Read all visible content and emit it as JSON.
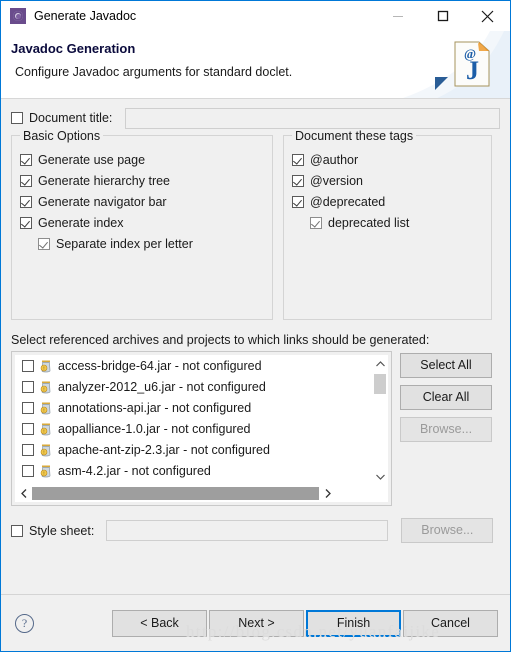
{
  "window": {
    "title": "Generate Javadoc",
    "icon": "gear-icon",
    "controls": {
      "minimize": "minimize-icon",
      "maximize": "maximize-icon",
      "close": "close-icon"
    }
  },
  "header": {
    "title": "Javadoc Generation",
    "subtitle": "Configure Javadoc arguments for standard doclet.",
    "logo": "javadoc-page-icon"
  },
  "document_title": {
    "label": "Document title:",
    "checked": false,
    "value": "",
    "placeholder": "",
    "enabled": false
  },
  "basic_options": {
    "title": "Basic Options",
    "items": [
      {
        "label": "Generate use page",
        "checked": true,
        "indent": false
      },
      {
        "label": "Generate hierarchy tree",
        "checked": true,
        "indent": false
      },
      {
        "label": "Generate navigator bar",
        "checked": true,
        "indent": false
      },
      {
        "label": "Generate index",
        "checked": true,
        "indent": false
      },
      {
        "label": "Separate index per letter",
        "checked": true,
        "indent": true
      }
    ]
  },
  "document_tags": {
    "title": "Document these tags",
    "items": [
      {
        "label": "@author",
        "checked": true,
        "indent": false
      },
      {
        "label": "@version",
        "checked": true,
        "indent": false
      },
      {
        "label": "@deprecated",
        "checked": true,
        "indent": false
      },
      {
        "label": "deprecated list",
        "checked": true,
        "indent": true
      }
    ]
  },
  "references": {
    "label": "Select referenced archives and projects to which links should be generated:",
    "items": [
      {
        "name": "access-bridge-64.jar - not configured",
        "checked": false,
        "icon": "jar-warning-icon"
      },
      {
        "name": "analyzer-2012_u6.jar - not configured",
        "checked": false,
        "icon": "jar-warning-icon"
      },
      {
        "name": "annotations-api.jar - not configured",
        "checked": false,
        "icon": "jar-warning-icon"
      },
      {
        "name": "aopalliance-1.0.jar - not configured",
        "checked": false,
        "icon": "jar-warning-icon"
      },
      {
        "name": "apache-ant-zip-2.3.jar - not configured",
        "checked": false,
        "icon": "jar-warning-icon"
      },
      {
        "name": "asm-4.2.jar - not configured",
        "checked": false,
        "icon": "jar-warning-icon"
      },
      {
        "name": "",
        "checked": false,
        "icon": "jar-warning-icon"
      }
    ],
    "buttons": {
      "select_all": "Select All",
      "clear_all": "Clear All",
      "browse": "Browse...",
      "browse_enabled": false
    },
    "scrollbars": {
      "vertical_up": "chevron-up-icon",
      "vertical_down": "chevron-down-icon",
      "horizontal_left": "chevron-left-icon",
      "horizontal_right": "chevron-right-icon"
    }
  },
  "style_sheet": {
    "label": "Style sheet:",
    "checked": false,
    "value": "",
    "placeholder": "",
    "browse_label": "Browse...",
    "browse_enabled": false
  },
  "footer": {
    "help": "help-icon",
    "buttons": [
      {
        "label": "< Back",
        "primary": false
      },
      {
        "label": "Next >",
        "primary": false
      },
      {
        "label": "Finish",
        "primary": true
      },
      {
        "label": "Cancel",
        "primary": false
      }
    ]
  },
  "watermark": "http://blog.csdn.net/yuanfaijike",
  "colors": {
    "accent": "#0078d7",
    "dialog_bg": "#f0f0f0",
    "titlebar_bg": "#ffffff",
    "header_title": "#0a0a3c",
    "button_bg": "#e1e1e1",
    "jar_icon": "#b9c3cc",
    "jar_badge": "#f0c040"
  }
}
